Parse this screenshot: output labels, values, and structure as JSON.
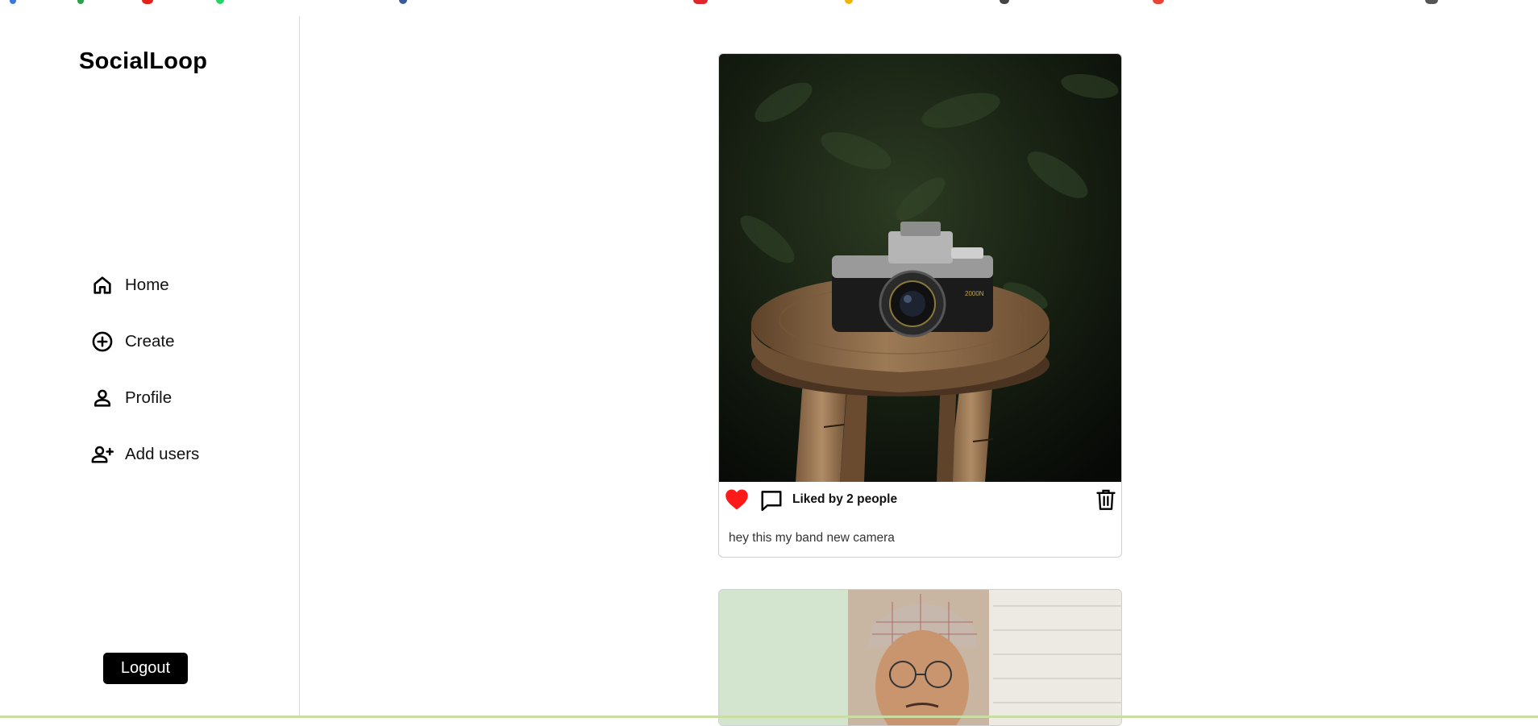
{
  "app": {
    "brand": "SocialLoop"
  },
  "sidebar": {
    "items": [
      {
        "label": "Home",
        "icon": "home-icon"
      },
      {
        "label": "Create",
        "icon": "plus-circle-icon"
      },
      {
        "label": "Profile",
        "icon": "person-icon"
      },
      {
        "label": "Add users",
        "icon": "person-add-icon"
      }
    ],
    "logout_label": "Logout"
  },
  "feed": {
    "posts": [
      {
        "likes_text": "Liked by 2 people",
        "caption": "hey this my band new camera",
        "liked": true,
        "image": "camera-on-wooden-stool-photo"
      },
      {
        "image": "person-with-cap-and-glasses-photo"
      }
    ]
  },
  "colors": {
    "like": "#ff1a1a",
    "accent": "#000000",
    "border": "#cfcfcf"
  }
}
